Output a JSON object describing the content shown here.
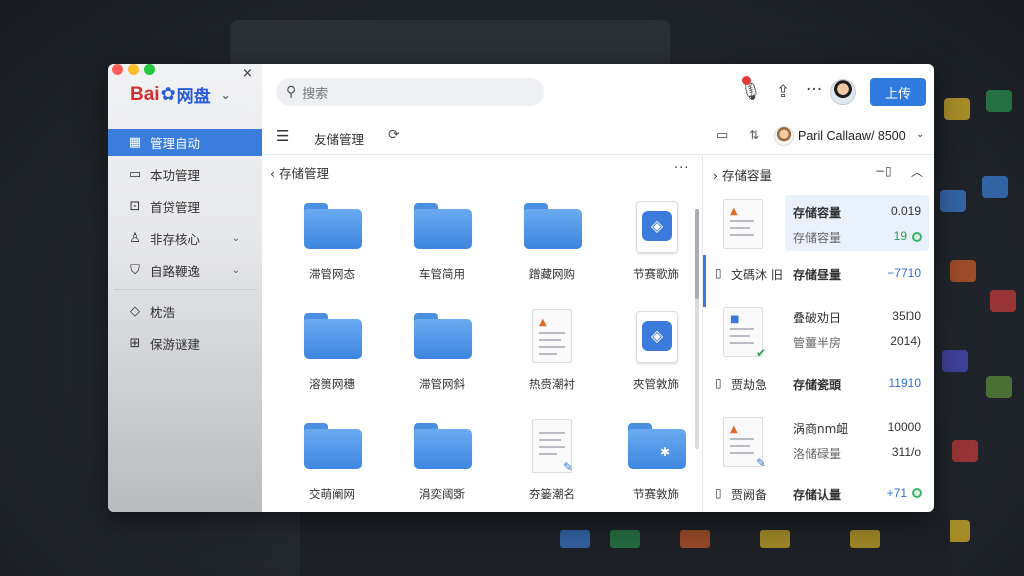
{
  "window": {
    "brand": {
      "latin": "Bai",
      "paw": "✿",
      "cn": "网盘"
    },
    "close": "×"
  },
  "sidebar": {
    "items": [
      {
        "label": "管理自动",
        "icon": "grid-icon",
        "active": true
      },
      {
        "label": "本功管理",
        "icon": "folder-icon"
      },
      {
        "label": "首贷管理",
        "icon": "box-icon"
      },
      {
        "label": "非存核心",
        "icon": "user-icon",
        "arrow": "⌄"
      },
      {
        "label": "自路鞭逸",
        "icon": "bag-icon",
        "arrow": "⌄"
      },
      {
        "label": "枕浩",
        "icon": "diamond-icon"
      },
      {
        "label": "保游谜建",
        "icon": "share-icon"
      }
    ]
  },
  "topbar": {
    "search_placeholder": "搜索",
    "upload_label": "上传",
    "more": "···"
  },
  "toolbar": {
    "title": "友储管理",
    "user_name": "Paril Callaaw/ 8500"
  },
  "files": {
    "header": "存储管理",
    "items": [
      {
        "label": "滞管网态",
        "type": "folder"
      },
      {
        "label": "车管简用",
        "type": "folder"
      },
      {
        "label": "蹭藏网购",
        "type": "folder"
      },
      {
        "label": "节赛歌斾",
        "type": "app"
      },
      {
        "label": "溶篑网穗",
        "type": "folder"
      },
      {
        "label": "滞管网斜",
        "type": "folder"
      },
      {
        "label": "热赍潮衬",
        "type": "doc"
      },
      {
        "label": "夾管敦斾",
        "type": "app"
      },
      {
        "label": "交萌阐网",
        "type": "folder"
      },
      {
        "label": "涓奕阈斲",
        "type": "folder"
      },
      {
        "label": "夯篓潮名",
        "type": "doc2"
      },
      {
        "label": "节赛敦斾",
        "type": "folder-star"
      }
    ]
  },
  "panel": {
    "header": "存储容量",
    "ctrl": "−▯",
    "rows": [
      {
        "l1": "存储容量",
        "v1": "0.019",
        "l2": "存储容量",
        "v2": "19"
      },
      {
        "file": "文碼沐 旧",
        "l1": "存储昼量",
        "v1": "−7710"
      },
      {
        "l1": "叠破劝日",
        "v1": "35Ŋ0",
        "l2": "管薑半房",
        "v2": "2014)"
      },
      {
        "file": "贾劫急",
        "l1": "存储瓷頭",
        "v1": "11910"
      },
      {
        "l1": "涡商nm衄",
        "v1": "10000",
        "l2": "洛储碌量",
        "v2": "311/o"
      },
      {
        "file": "贾阙备",
        "l1": "存储认量",
        "v1": "+71"
      }
    ]
  }
}
